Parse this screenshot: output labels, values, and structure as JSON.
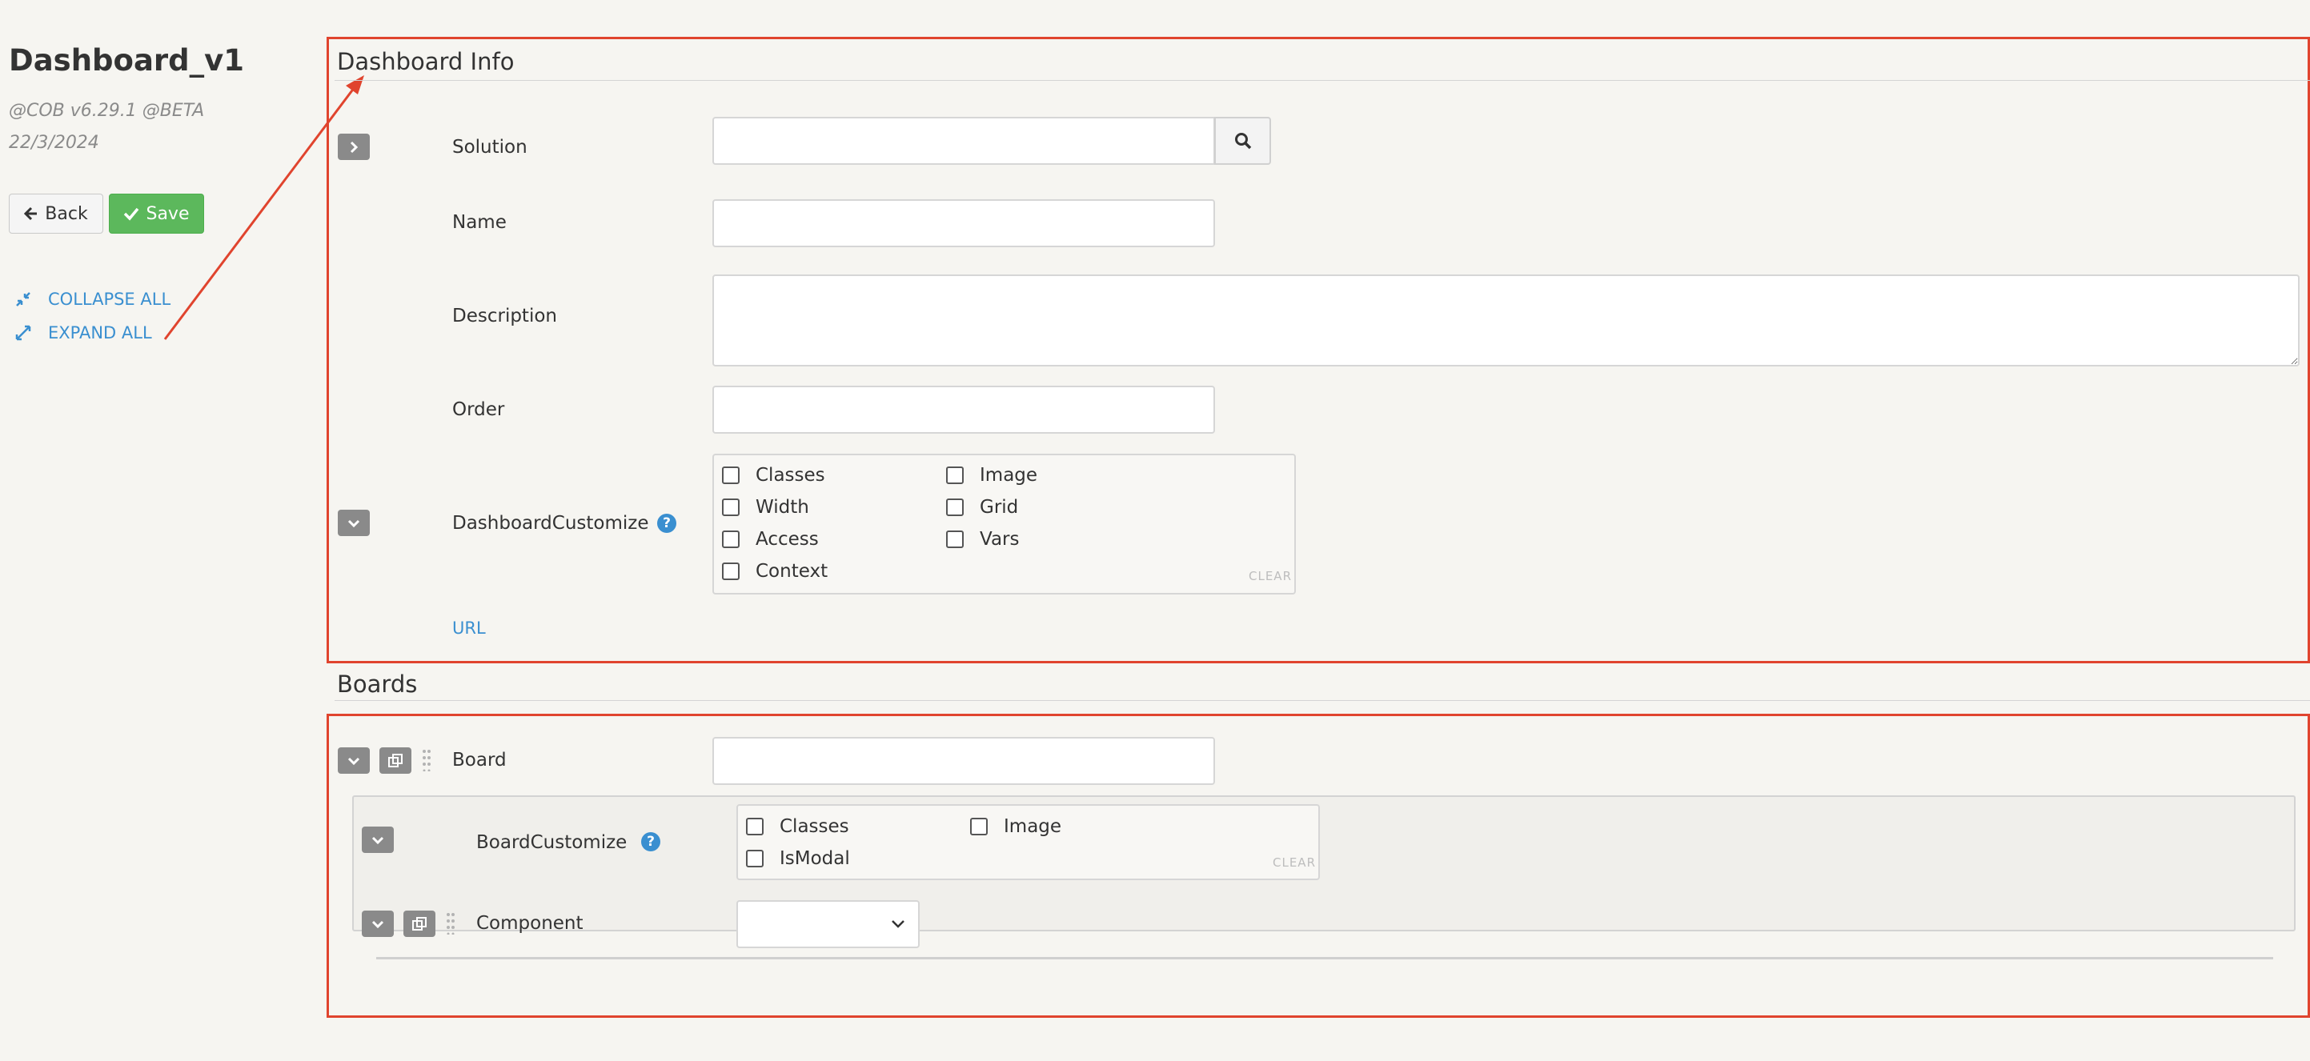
{
  "page": {
    "title": "Dashboard_v1",
    "version": "@COB v6.29.1 @BETA",
    "date": "22/3/2024"
  },
  "toolbar": {
    "back_label": "Back",
    "save_label": "Save"
  },
  "side_links": {
    "collapse_all": "COLLAPSE ALL",
    "expand_all": "EXPAND ALL"
  },
  "dashboard_info": {
    "heading": "Dashboard Info",
    "solution_label": "Solution",
    "solution_value": "",
    "name_label": "Name",
    "name_value": "",
    "description_label": "Description",
    "description_value": "",
    "order_label": "Order",
    "order_value": "",
    "customize_label": "DashboardCustomize",
    "customize_options": [
      "Classes",
      "Width",
      "Access",
      "Context",
      "Image",
      "Grid",
      "Vars"
    ],
    "clear_label": "CLEAR",
    "url_label": "URL"
  },
  "boards": {
    "heading": "Boards",
    "board_label": "Board",
    "board_value": "",
    "customize_label": "BoardCustomize",
    "customize_options": [
      "Classes",
      "IsModal",
      "Image"
    ],
    "clear_label": "CLEAR",
    "component_label": "Component",
    "component_value": ""
  },
  "colors": {
    "annotation_red": "#e0442e",
    "link_blue": "#3a8fd0",
    "save_green": "#5cb85c",
    "background": "#f6f5f1"
  },
  "icons": [
    "arrow-left-icon",
    "check-icon",
    "compress-icon",
    "expand-icon",
    "search-icon",
    "chevron-right-icon",
    "chevron-down-icon",
    "copy-icon",
    "grip-icon",
    "help-icon"
  ]
}
